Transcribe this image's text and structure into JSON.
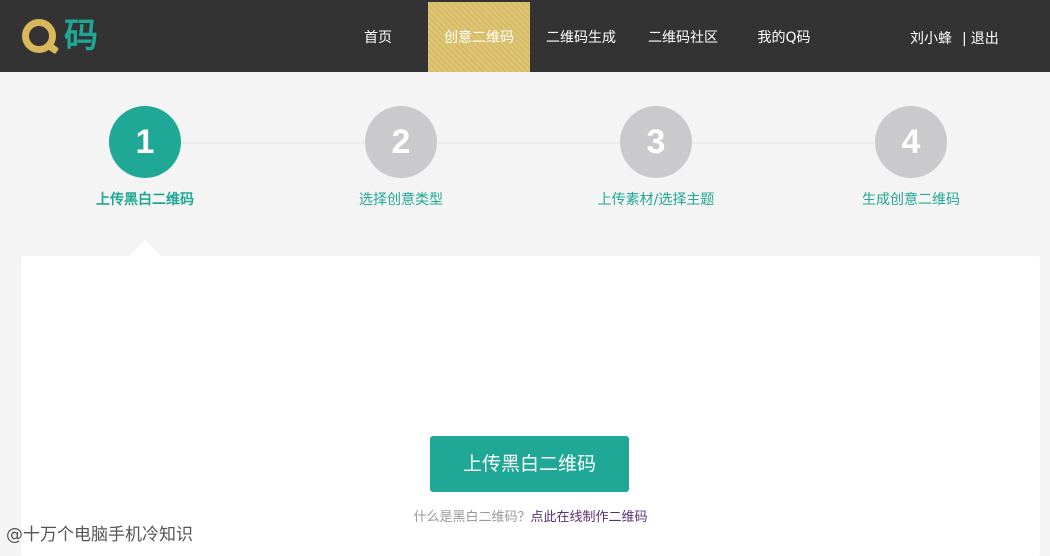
{
  "brand": {
    "logo_text": "码",
    "accent": "#1fa895",
    "gold": "#ddc26b"
  },
  "nav": {
    "items": [
      {
        "label": "首页"
      },
      {
        "label": "创意二维码"
      },
      {
        "label": "二维码生成"
      },
      {
        "label": "二维码社区"
      },
      {
        "label": "我的Q码"
      }
    ],
    "active_index": 1
  },
  "user": {
    "name": "刘小蜂",
    "separator": "|",
    "logout": "退出"
  },
  "steps": [
    {
      "number": "1",
      "label": "上传黑白二维码",
      "active": true
    },
    {
      "number": "2",
      "label": "选择创意类型",
      "active": false
    },
    {
      "number": "3",
      "label": "上传素材/选择主题",
      "active": false
    },
    {
      "number": "4",
      "label": "生成创意二维码",
      "active": false
    }
  ],
  "main": {
    "upload_button": "上传黑白二维码",
    "help_question": "什么是黑白二维码？",
    "help_link": "点此在线制作二维码"
  },
  "watermark": "@十万个电脑手机冷知识"
}
